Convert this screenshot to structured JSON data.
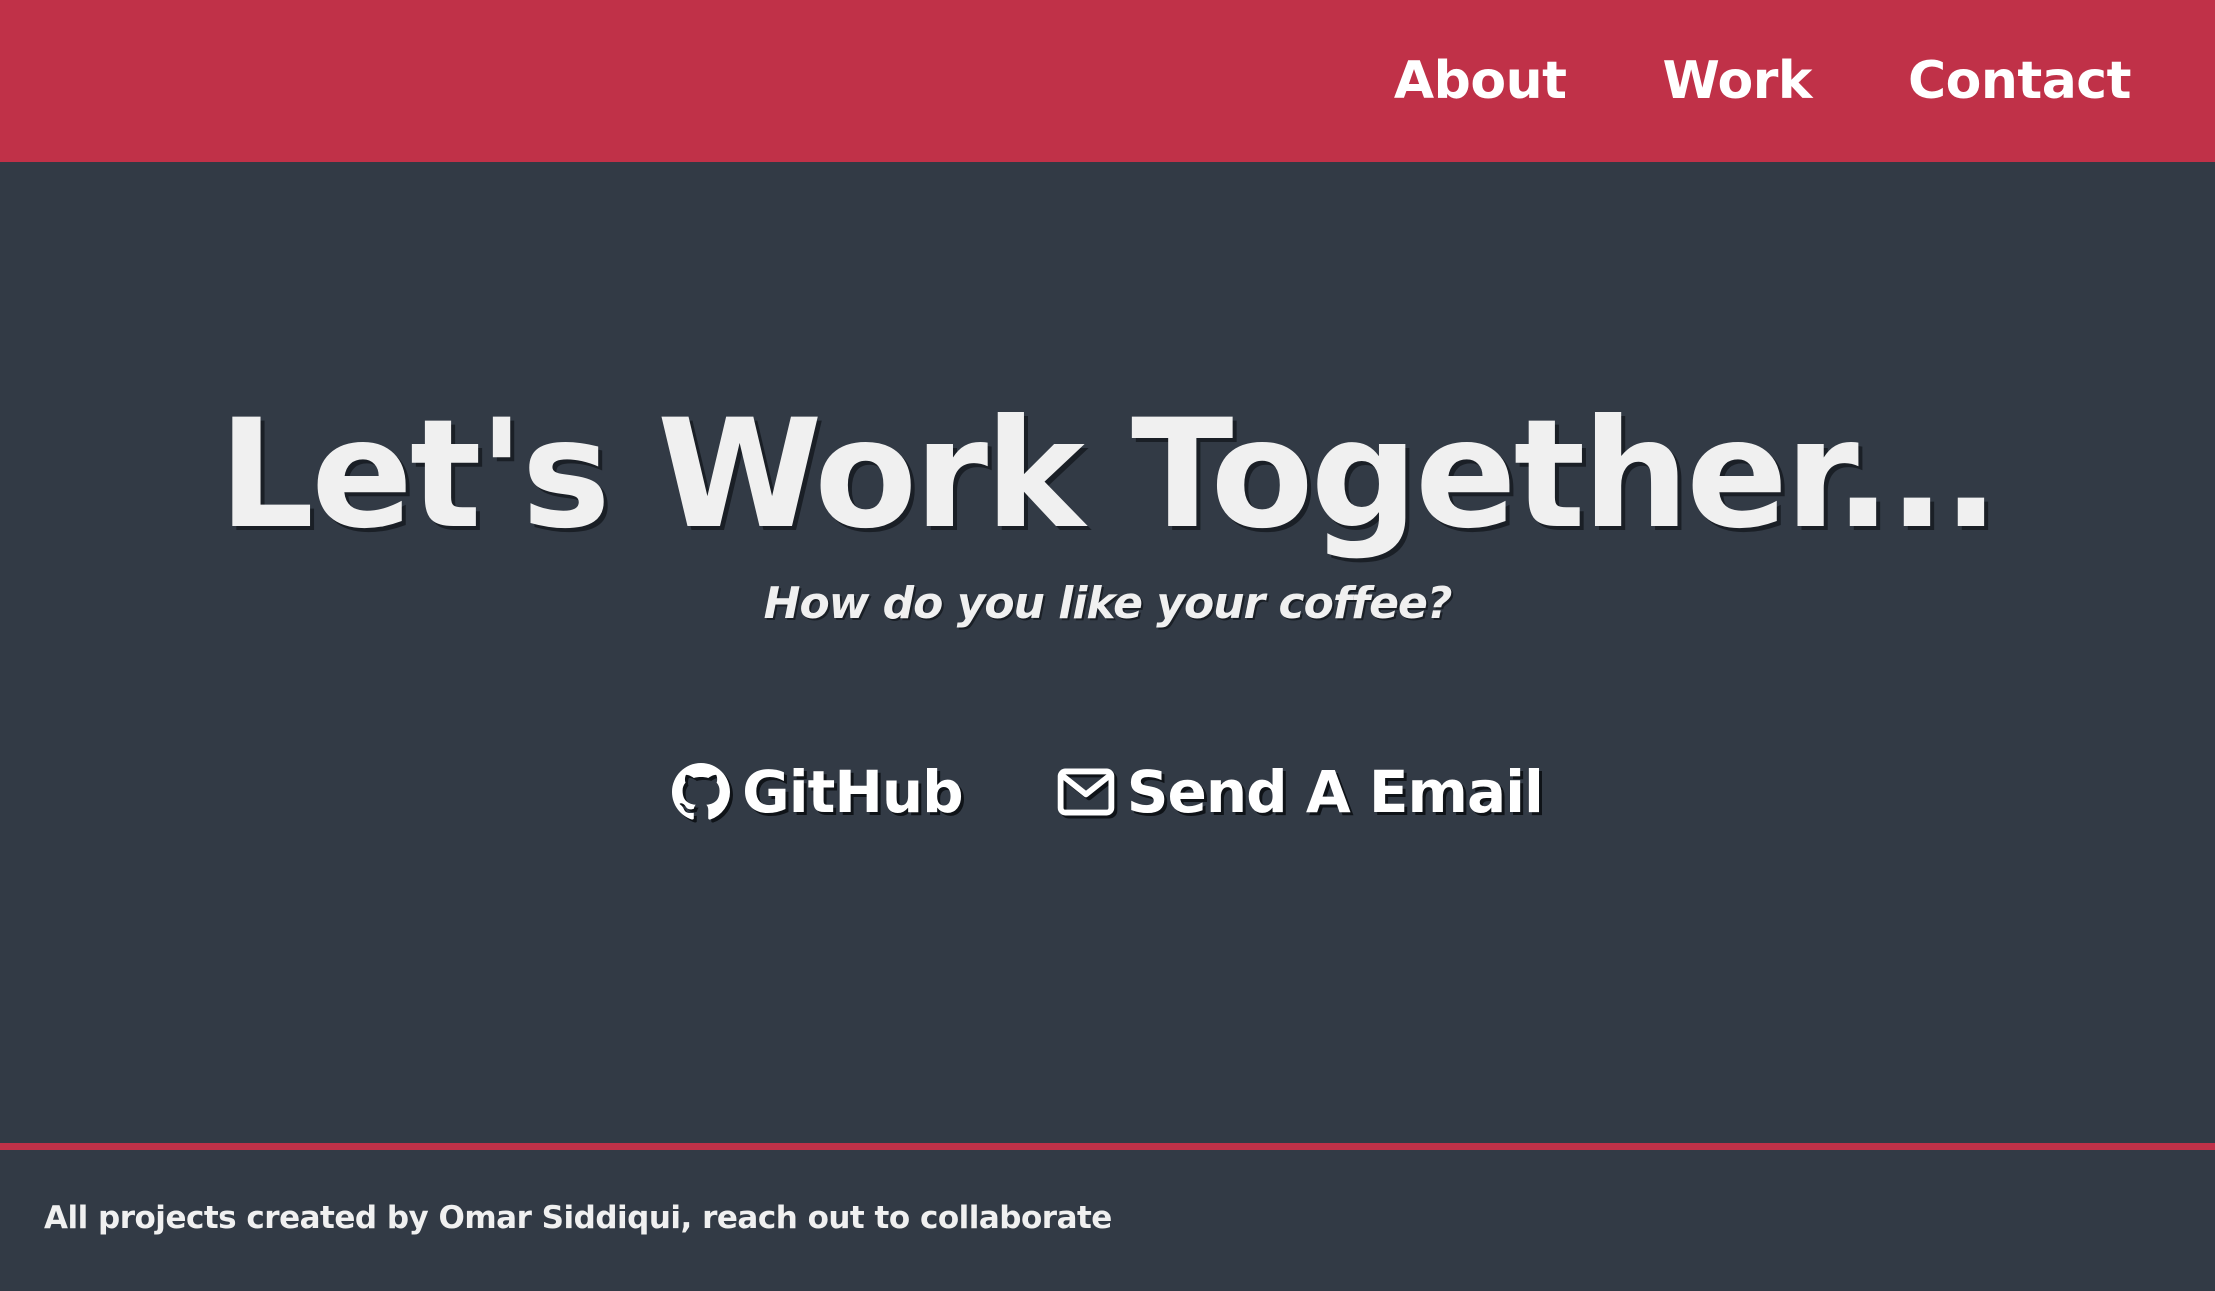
{
  "nav": {
    "items": [
      {
        "label": "About"
      },
      {
        "label": "Work"
      },
      {
        "label": "Contact"
      }
    ]
  },
  "hero": {
    "title": "Let's Work Together...",
    "subtitle": "How do you like your coffee?"
  },
  "links": {
    "github": {
      "label": "GitHub",
      "icon": "github-icon"
    },
    "email": {
      "label": "Send A Email",
      "icon": "envelope-icon"
    }
  },
  "footer": {
    "text": "All projects created by Omar Siddiqui, reach out to collaborate"
  },
  "colors": {
    "accent": "#c03148",
    "background": "#323a45",
    "text": "#f0f0f0"
  }
}
